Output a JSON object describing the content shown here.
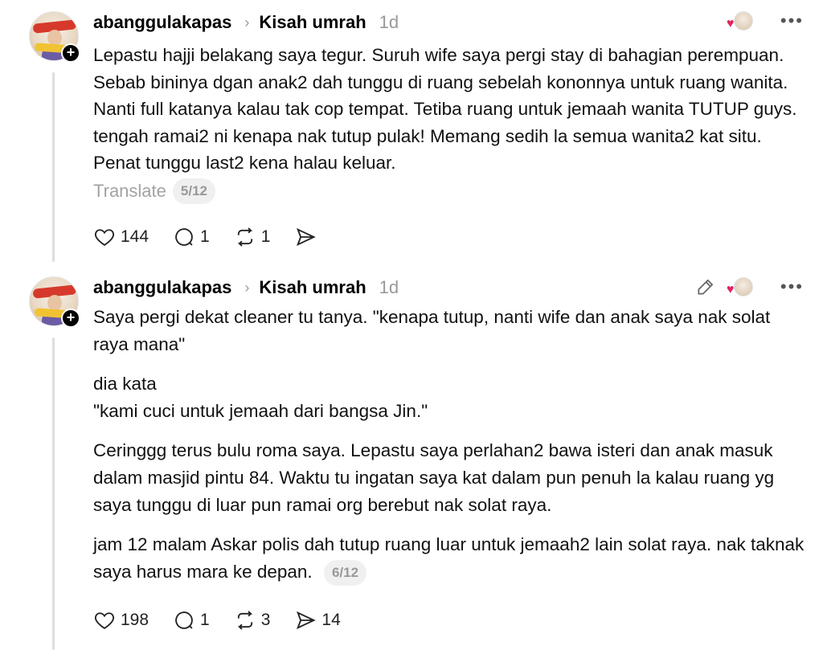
{
  "posts": [
    {
      "username": "abanggulakapas",
      "topic": "Kisah umrah",
      "time": "1d",
      "paragraphs": [
        "Lepastu hajji belakang saya tegur. Suruh wife saya pergi stay di bahagian perempuan. Sebab bininya dgan anak2 dah tunggu di ruang sebelah kononnya untuk ruang wanita. Nanti full katanya kalau tak cop tempat. Tetiba ruang untuk jemaah wanita TUTUP guys. tengah ramai2 ni kenapa nak tutup pulak! Memang sedih la semua wanita2 kat situ. Penat tunggu last2 kena halau keluar."
      ],
      "translate_label": "Translate",
      "page_indicator": "5/12",
      "likes": "144",
      "replies": "1",
      "reposts": "1",
      "shares": ""
    },
    {
      "username": "abanggulakapas",
      "topic": "Kisah umrah",
      "time": "1d",
      "paragraphs": [
        "Saya pergi dekat cleaner tu tanya. \"kenapa tutup, nanti wife dan anak saya nak solat raya mana\"",
        "dia kata\n\"kami cuci untuk jemaah dari bangsa Jin.\"",
        "Ceringgg terus bulu roma saya. Lepastu saya perlahan2 bawa isteri dan anak masuk dalam masjid pintu 84. Waktu tu ingatan saya kat dalam pun penuh la kalau ruang yg saya tunggu di luar pun ramai org berebut nak solat raya.",
        "jam 12 malam Askar polis dah tutup ruang luar untuk jemaah2 lain solat raya. nak taknak saya harus mara ke depan."
      ],
      "page_indicator": "6/12",
      "likes": "198",
      "replies": "1",
      "reposts": "3",
      "shares": "14"
    }
  ],
  "icons": {
    "like": "heart-icon",
    "reply": "comment-icon",
    "repost": "repost-icon",
    "share": "share-icon",
    "more": "more-icon",
    "edit": "pencil-icon",
    "follow": "plus-icon"
  },
  "colors": {
    "text": "#111111",
    "muted": "#999999",
    "heart": "#e0245e",
    "pill_bg": "#f0f0f0"
  }
}
